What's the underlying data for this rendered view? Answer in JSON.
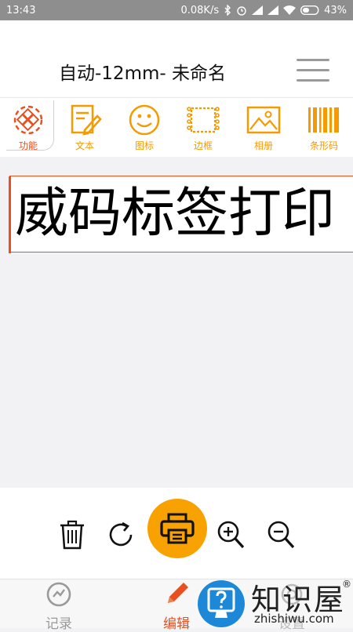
{
  "status": {
    "time": "13:43",
    "speed": "0.08K/s",
    "battery": "43%"
  },
  "header": {
    "title": "自动-12mm- 未命名",
    "menu_icon": "hamburger-menu-icon"
  },
  "toolbar": {
    "items": [
      {
        "label": "功能",
        "icon": "function-icon"
      },
      {
        "label": "文本",
        "icon": "text-edit-icon"
      },
      {
        "label": "图标",
        "icon": "smiley-icon"
      },
      {
        "label": "边框",
        "icon": "border-icon"
      },
      {
        "label": "相册",
        "icon": "photo-album-icon"
      },
      {
        "label": "条形码",
        "icon": "barcode-icon"
      }
    ]
  },
  "canvas": {
    "label_text": "威码标签打印"
  },
  "actions": {
    "items": [
      "trash-icon",
      "rotate-icon",
      "print-icon",
      "zoom-in-icon",
      "zoom-out-icon"
    ]
  },
  "tabbar": {
    "items": [
      {
        "label": "记录",
        "icon": "record-icon"
      },
      {
        "label": "编辑",
        "icon": "pencil-icon"
      },
      {
        "label": "设置",
        "icon": "settings-icon"
      }
    ]
  },
  "watermark": {
    "title": "知识屋",
    "reg": "®",
    "url": "zhishiwu.com"
  },
  "colors": {
    "accent": "#f59a00",
    "active": "#e8501f",
    "status_bar": "#8e8e8e"
  }
}
